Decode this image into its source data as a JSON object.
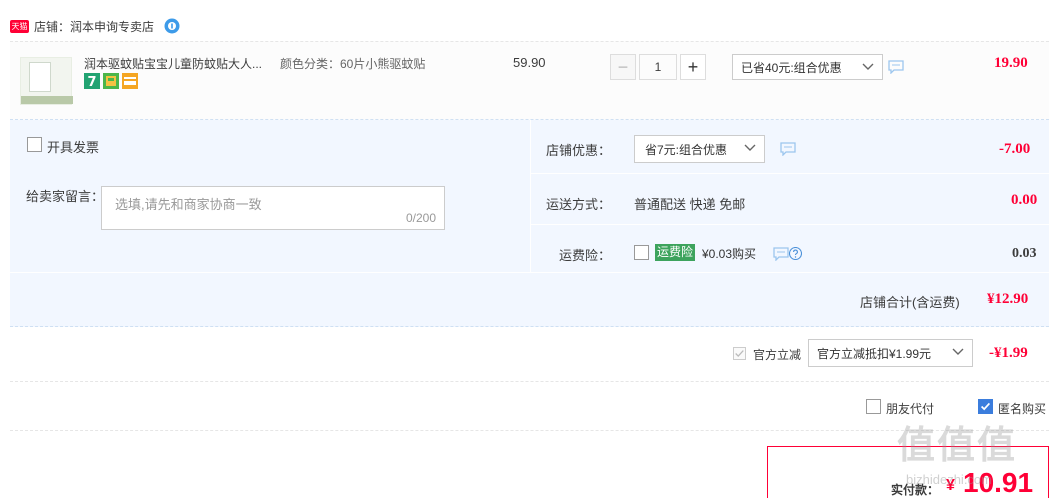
{
  "shop": {
    "badge": "天猫",
    "label": "店铺：润本申询专卖店"
  },
  "item": {
    "title": "润本驱蚊贴宝宝儿童防蚊贴大人...",
    "spec": "颜色分类：60片小熊驱蚊贴",
    "unit_price": "59.90",
    "quantity": "1",
    "promo": "已省40元:组合优惠",
    "total": "19.90",
    "badge_seven": "7"
  },
  "invoice": {
    "label": "开具发票"
  },
  "message": {
    "label": "给卖家留言：",
    "placeholder": "选填,请先和商家协商一致",
    "count": "0/200"
  },
  "shop_promo": {
    "label": "店铺优惠：",
    "select": "省7元:组合优惠",
    "value": "-7.00"
  },
  "shipping": {
    "label": "运送方式：",
    "method": "普通配送 快递 免邮",
    "value": "0.00"
  },
  "insurance": {
    "label": "运费险：",
    "tag": "运费险",
    "price": "¥0.03购买",
    "value": "0.03"
  },
  "shop_total": {
    "label": "店铺合计(含运费)",
    "value": "¥12.90"
  },
  "official": {
    "label": "官方立减",
    "select": "官方立减抵扣¥1.99元",
    "value": "-¥1.99"
  },
  "friend_pay": {
    "label": "朋友代付"
  },
  "anonymous": {
    "label": "匿名购买"
  },
  "pay": {
    "label": "实付款：",
    "currency": "¥",
    "value": "10.91"
  },
  "watermark": {
    "text": "值值值",
    "sub": "bizhidezhi.com"
  },
  "colors": {
    "price_red": "#ff0036",
    "panel_blue": "#f2f7ff",
    "check_blue": "#3b7ddd",
    "insurance_green": "#3da35d"
  }
}
